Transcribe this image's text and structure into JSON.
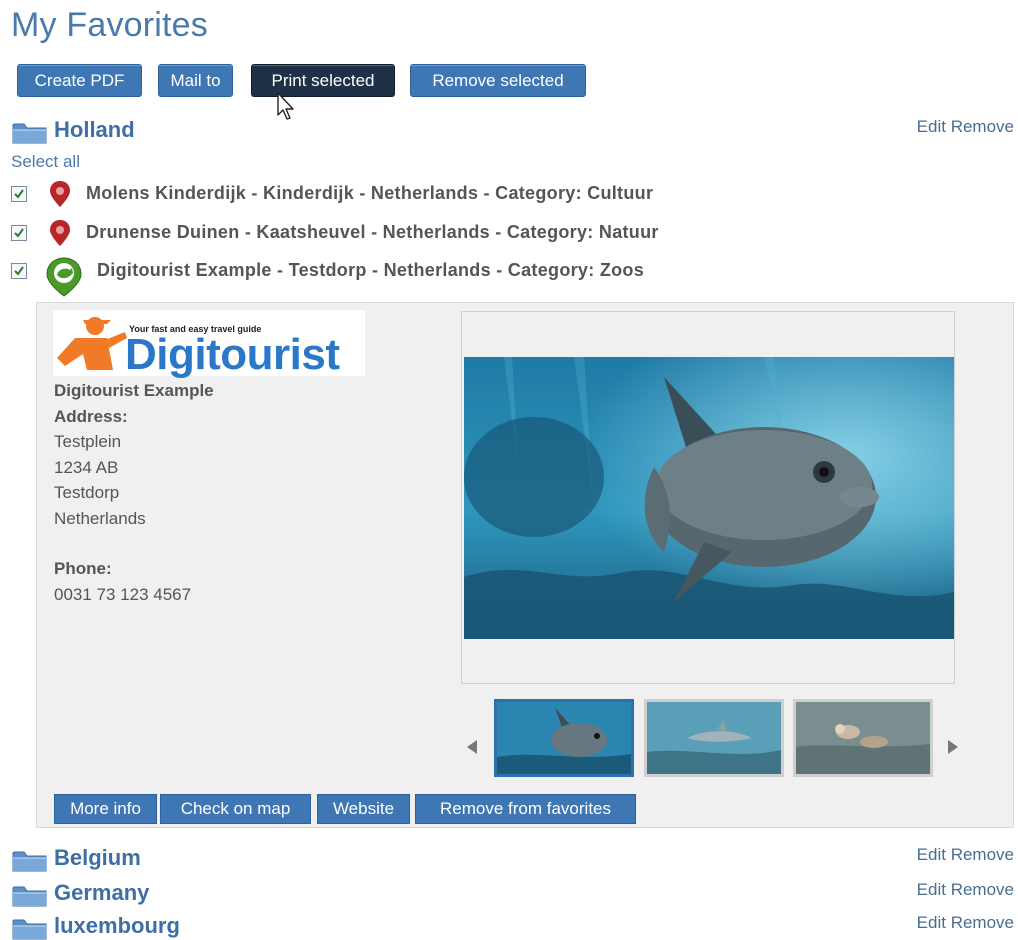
{
  "page": {
    "title": "My Favorites"
  },
  "toolbar": {
    "create_pdf": "Create PDF",
    "mail_to": "Mail to",
    "print_selected": "Print selected",
    "remove_selected": "Remove selected"
  },
  "folders": [
    {
      "name": "Holland",
      "edit": "Edit",
      "remove": "Remove"
    },
    {
      "name": "Belgium",
      "edit": "Edit",
      "remove": "Remove"
    },
    {
      "name": "Germany",
      "edit": "Edit",
      "remove": "Remove"
    },
    {
      "name": "luxembourg",
      "edit": "Edit",
      "remove": "Remove"
    }
  ],
  "select_all": "Select all",
  "favorites": [
    {
      "text": "Molens Kinderdijk - Kinderdijk - Netherlands - Category: Cultuur",
      "checked": true,
      "pin": "red-map-pin-icon"
    },
    {
      "text": "Drunense Duinen - Kaatsheuvel - Netherlands - Category: Natuur",
      "checked": true,
      "pin": "red-map-pin-icon"
    },
    {
      "text": "Digitourist Example - Testdorp - Netherlands - Category: Zoos",
      "checked": true,
      "pin": "green-map-pin-icon"
    }
  ],
  "detail": {
    "logo_tagline": "Your fast and easy travel guide",
    "logo_word": "Digitourist",
    "name": "Digitourist Example",
    "address_label": "Address:",
    "address_lines": [
      "Testplein",
      "1234 AB",
      "Testdorp",
      "Netherlands"
    ],
    "phone_label": "Phone:",
    "phone": "0031 73 123 4567",
    "buttons": {
      "more_info": "More info",
      "check_on_map": "Check on map",
      "website": "Website",
      "remove_from_favorites": "Remove from favorites"
    }
  },
  "colors": {
    "accent": "#3f77b4",
    "title": "#4a7aab",
    "dark_button": "#1e3147"
  }
}
